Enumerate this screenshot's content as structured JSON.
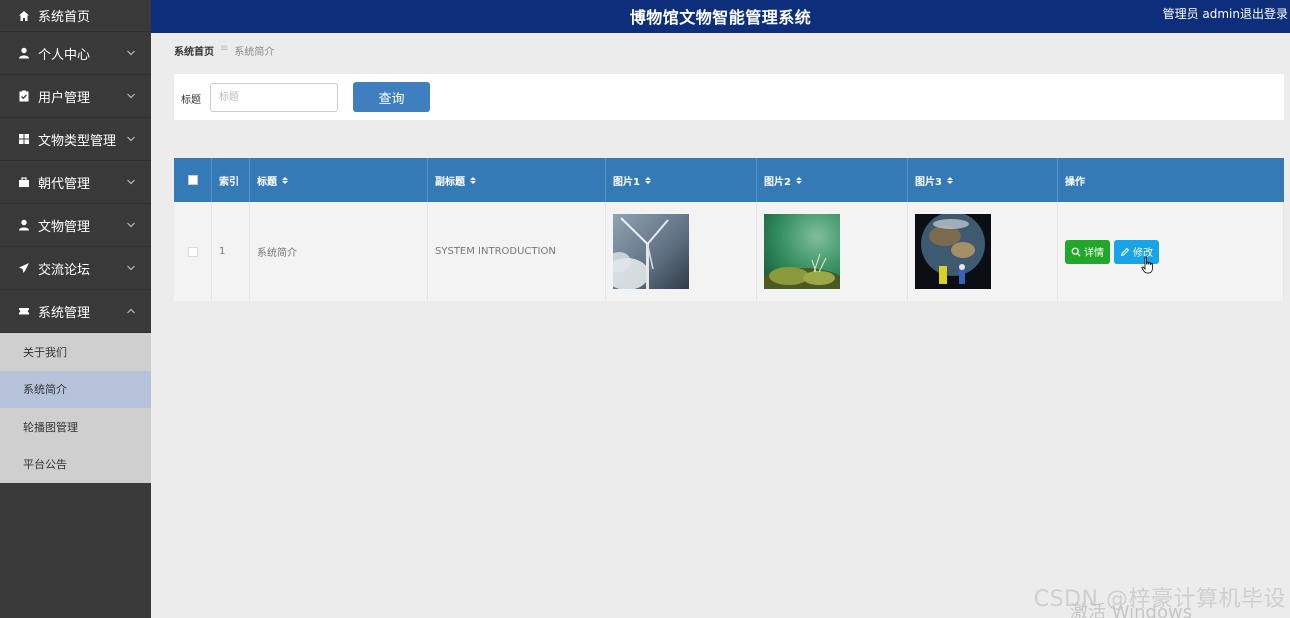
{
  "header": {
    "title": "博物馆文物智能管理系统",
    "admin_text": "管理员 admin",
    "logout_label": "退出登录",
    "bg_color": "#0d2e7a"
  },
  "sidebar": {
    "items": [
      {
        "label": "系统首页",
        "icon": "home-icon"
      },
      {
        "label": "个人中心",
        "icon": "user-icon"
      },
      {
        "label": "用户管理",
        "icon": "clipboard-icon"
      },
      {
        "label": "文物类型管理",
        "icon": "grid-icon"
      },
      {
        "label": "朝代管理",
        "icon": "briefcase-icon"
      },
      {
        "label": "文物管理",
        "icon": "user-icon"
      },
      {
        "label": "交流论坛",
        "icon": "send-icon"
      },
      {
        "label": "系统管理",
        "icon": "ticket-icon"
      }
    ],
    "submenu": [
      {
        "label": "关于我们"
      },
      {
        "label": "系统简介",
        "active": true
      },
      {
        "label": "轮播图管理"
      },
      {
        "label": "平台公告"
      }
    ]
  },
  "breadcrumb": {
    "home": "系统首页",
    "separator": "≡",
    "current": "系统简介"
  },
  "search": {
    "label": "标题",
    "placeholder": "标题",
    "button_label": "查询"
  },
  "table": {
    "columns": [
      "",
      "索引",
      "标题",
      "副标题",
      "图片1",
      "图片2",
      "图片3",
      "操作"
    ],
    "header_color": "#337ab7",
    "rows": [
      {
        "index": "1",
        "title": "系统简介",
        "subtitle": "SYSTEM INTRODUCTION",
        "images": [
          "wind-turbine-image",
          "moss-plant-image",
          "earth-astronaut-image"
        ],
        "actions": {
          "detail": "详情",
          "edit": "修改"
        }
      }
    ]
  },
  "watermark": {
    "csdn": "CSDN @梓豪计算机毕设",
    "windows": "激活 Windows"
  }
}
